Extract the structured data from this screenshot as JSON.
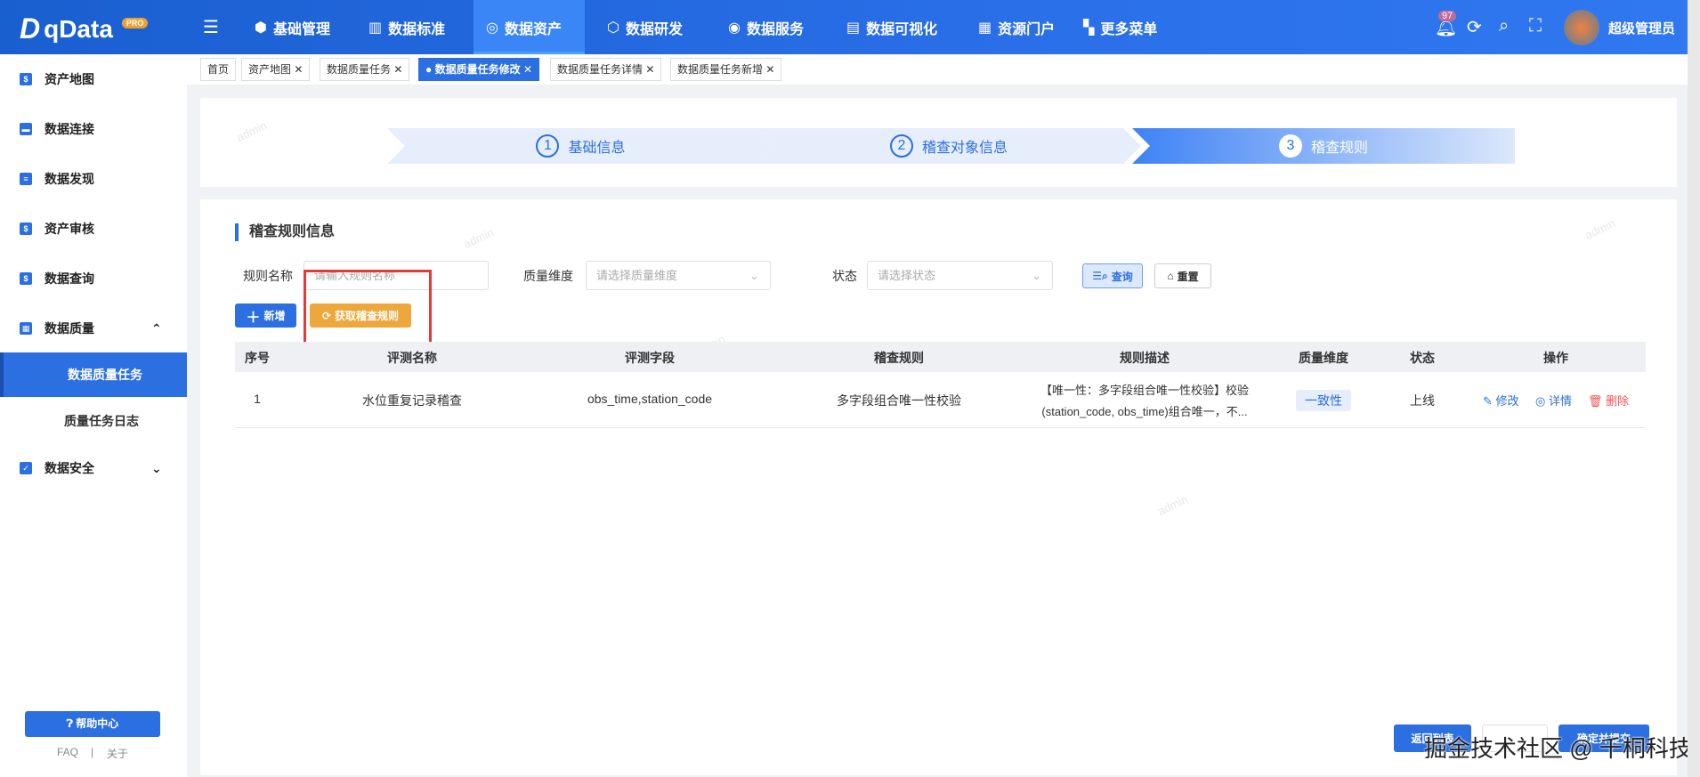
{
  "header": {
    "logo": "qData",
    "logo_badge": "PRO",
    "nav": [
      "基础管理",
      "数据标准",
      "数据资产",
      "数据研发",
      "数据服务",
      "数据可视化",
      "资源门户",
      "更多菜单"
    ],
    "active_nav": "数据资产",
    "notification_count": "97",
    "user": "超级管理员"
  },
  "sidebar": {
    "items": [
      "资产地图",
      "数据连接",
      "数据发现",
      "资产审核",
      "数据查询",
      "数据质量"
    ],
    "quality_sub": [
      "数据质量任务",
      "质量任务日志"
    ],
    "security": "数据安全",
    "help": "帮助中心",
    "faq": "FAQ",
    "about": "关于"
  },
  "tabs": [
    "首页",
    "资产地图",
    "数据质量任务",
    "数据质量任务修改",
    "数据质量任务详情",
    "数据质量任务新增"
  ],
  "steps": [
    {
      "n": "1",
      "label": "基础信息"
    },
    {
      "n": "2",
      "label": "稽查对象信息"
    },
    {
      "n": "3",
      "label": "稽查规则"
    }
  ],
  "section_title": "稽查规则信息",
  "filters": {
    "rule_name_label": "规则名称",
    "rule_name_placeholder": "请输入规则名称",
    "dimension_label": "质量维度",
    "dimension_placeholder": "请选择质量维度",
    "status_label": "状态",
    "status_placeholder": "请选择状态",
    "query": "查询",
    "reset": "重置"
  },
  "actions": {
    "add": "新增",
    "fetch": "获取稽查规则"
  },
  "table": {
    "columns": [
      "序号",
      "评测名称",
      "评测字段",
      "稽查规则",
      "规则描述",
      "质量维度",
      "状态",
      "操作"
    ],
    "rows": [
      {
        "no": "1",
        "name": "水位重复记录稽查",
        "field": "obs_time,station_code",
        "rule": "多字段组合唯一性校验",
        "desc1": "【唯一性：多字段组合唯一性校验】校验",
        "desc2": "(station_code, obs_time)组合唯一，不...",
        "dimension": "一致性",
        "status": "上线",
        "edit": "修改",
        "detail": "详情",
        "delete": "删除"
      }
    ]
  },
  "footer": {
    "back": "返回列表",
    "save": "",
    "confirm": "确定并提交"
  },
  "watermark": "admin",
  "overlay_watermark": "掘金技术社区 @ 千桐科技"
}
